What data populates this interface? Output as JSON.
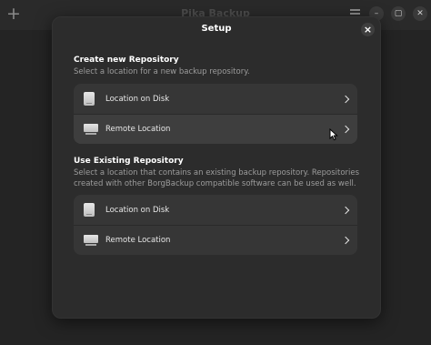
{
  "window": {
    "title": "Pika Backup",
    "add_glyph": "+",
    "controls": {
      "minimize": "–",
      "maximize": "▢",
      "close": "✕"
    }
  },
  "dialog": {
    "title": "Setup",
    "close_glyph": "×",
    "create_section": {
      "heading": "Create new Repository",
      "description": "Select a location for a new backup repository.",
      "rows": [
        {
          "label": "Location on Disk",
          "icon": "drive-icon"
        },
        {
          "label": "Remote Location",
          "icon": "network-computer-icon"
        }
      ]
    },
    "existing_section": {
      "heading": "Use Existing Repository",
      "description": "Select a location that contains an existing backup repository. Repositories created with other BorgBackup compatible software can be used as well.",
      "rows": [
        {
          "label": "Location on Disk",
          "icon": "drive-icon"
        },
        {
          "label": "Remote Location",
          "icon": "network-computer-icon"
        }
      ]
    }
  },
  "colors": {
    "dialog_bg": "#2c2c2c",
    "row_bg": "#363636",
    "text_primary": "#ffffff",
    "text_secondary": "#9c9c9c"
  }
}
